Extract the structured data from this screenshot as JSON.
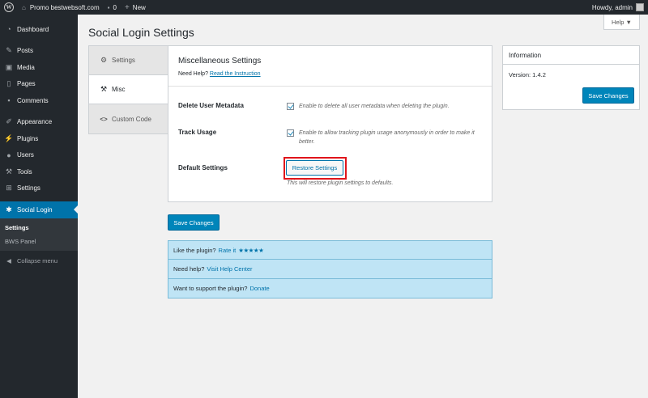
{
  "admin_bar": {
    "site_name": "Promo bestwebsoft.com",
    "comments_count": "0",
    "new_label": "New",
    "howdy": "Howdy, admin"
  },
  "sidebar": {
    "items": [
      {
        "label": "Dashboard",
        "icon": "dashboard-icon"
      },
      {
        "label": "Posts",
        "icon": "pin-icon"
      },
      {
        "label": "Media",
        "icon": "media-icon"
      },
      {
        "label": "Pages",
        "icon": "page-icon"
      },
      {
        "label": "Comments",
        "icon": "comment-icon"
      },
      {
        "label": "Appearance",
        "icon": "brush-icon"
      },
      {
        "label": "Plugins",
        "icon": "plug-icon"
      },
      {
        "label": "Users",
        "icon": "user-icon"
      },
      {
        "label": "Tools",
        "icon": "wrench-icon"
      },
      {
        "label": "Settings",
        "icon": "settings-icon"
      },
      {
        "label": "Social Login",
        "icon": "asterisk-icon"
      }
    ],
    "submenu": [
      "Settings",
      "BWS Panel"
    ],
    "collapse": "Collapse menu"
  },
  "help_tab": "Help ▼",
  "page_title": "Social Login Settings",
  "tabs": [
    {
      "label": "Settings",
      "icon": "gear-icon"
    },
    {
      "label": "Misc",
      "icon": "wrench-icon"
    },
    {
      "label": "Custom Code",
      "icon": "code-icon"
    }
  ],
  "panel": {
    "title": "Miscellaneous Settings",
    "help_prefix": "Need Help? ",
    "help_link": "Read the Instruction",
    "delete_label": "Delete User Metadata",
    "delete_desc": "Enable to delete all user metadata when deleting the plugin.",
    "track_label": "Track Usage",
    "track_desc": "Enable to allow tracking plugin usage anonymously in order to make it better.",
    "default_label": "Default Settings",
    "restore_button": "Restore Settings",
    "restore_desc": "This will restore plugin settings to defaults."
  },
  "save_changes": "Save Changes",
  "info": {
    "title": "Information",
    "version": "Version: 1.4.2",
    "save": "Save Changes"
  },
  "promo": {
    "rate_prefix": "Like the plugin?",
    "rate_link": "Rate it",
    "stars": "★★★★★",
    "help_prefix": "Need help?",
    "help_link": "Visit Help Center",
    "donate_prefix": "Want to support the plugin?",
    "donate_link": "Donate"
  },
  "colors": {
    "admin_bg": "#23282d",
    "accent": "#0073aa",
    "primary_button": "#0085ba",
    "highlight": "#e0151b",
    "promo_bg": "#bfe4f5"
  }
}
